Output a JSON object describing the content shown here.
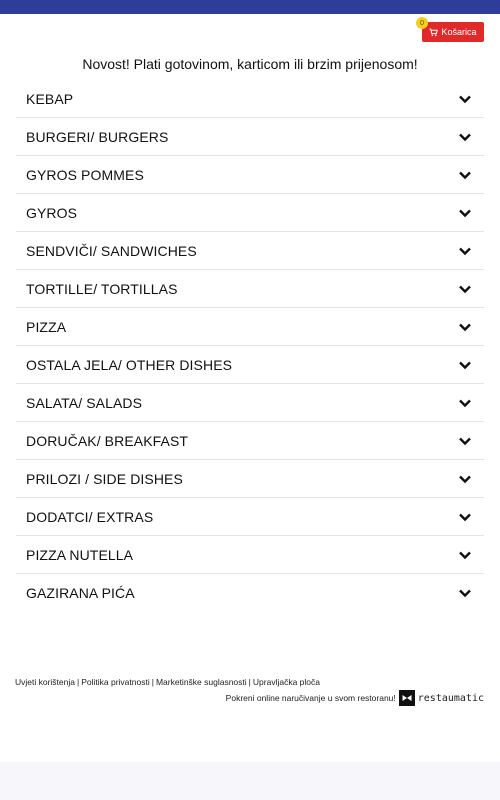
{
  "colors": {
    "topbar": "#2f3d9a",
    "cart": "#e02a2a",
    "badge": "#f3cf1f"
  },
  "cart": {
    "label": "Košarica",
    "count": "0",
    "icon": "cart-icon"
  },
  "notice": "Novost! Plati gotovinom, karticom ili brzim prijenosom!",
  "menu": {
    "items": [
      {
        "label": "KEBAP"
      },
      {
        "label": "BURGERI/ BURGERS"
      },
      {
        "label": "GYROS POMMES"
      },
      {
        "label": "GYROS"
      },
      {
        "label": "SENDVIČI/ SANDWICHES"
      },
      {
        "label": "TORTILLE/ TORTILLAS"
      },
      {
        "label": "PIZZA"
      },
      {
        "label": "OSTALA JELA/ OTHER DISHES"
      },
      {
        "label": "SALATA/ SALADS"
      },
      {
        "label": "DORUČAK/ BREAKFAST"
      },
      {
        "label": "PRILOZI / SIDE DISHES"
      },
      {
        "label": "DODATCI/ EXTRAS"
      },
      {
        "label": "PIZZA NUTELLA"
      },
      {
        "label": "GAZIRANA PIĆA"
      }
    ]
  },
  "footer": {
    "links": [
      "Uvjeti korištenja",
      "Politika privatnosti",
      "Marketinške suglasnosti",
      "Upravljačka ploča"
    ],
    "separator": "|",
    "powered_text": "Pokreni online naručivanje u svom restoranu!",
    "brand": "restaumatic"
  }
}
